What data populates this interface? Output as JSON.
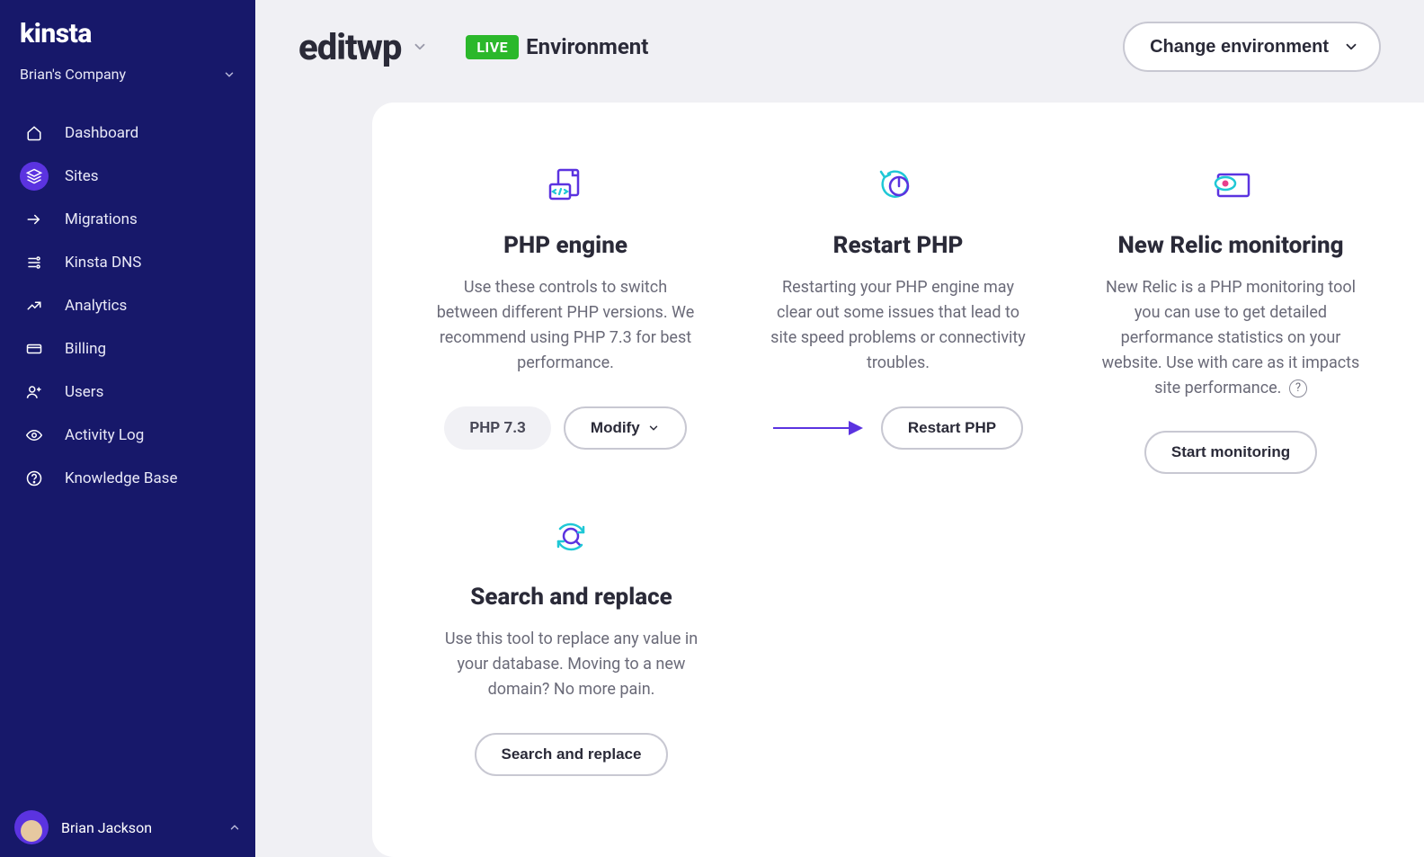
{
  "brand": "KINSTA",
  "company_name": "Brian's Company",
  "nav": [
    {
      "label": "Dashboard",
      "icon": "home-icon"
    },
    {
      "label": "Sites",
      "icon": "layers-icon",
      "active": true
    },
    {
      "label": "Migrations",
      "icon": "migration-icon"
    },
    {
      "label": "Kinsta DNS",
      "icon": "dns-icon"
    },
    {
      "label": "Analytics",
      "icon": "analytics-icon"
    },
    {
      "label": "Billing",
      "icon": "billing-icon"
    },
    {
      "label": "Users",
      "icon": "users-icon"
    },
    {
      "label": "Activity Log",
      "icon": "eye-icon"
    },
    {
      "label": "Knowledge Base",
      "icon": "help-icon"
    }
  ],
  "user_name": "Brian Jackson",
  "header": {
    "site_title": "editwp",
    "live_badge": "LIVE",
    "env_label": "Environment",
    "change_env": "Change environment"
  },
  "cards": {
    "php_engine": {
      "title": "PHP engine",
      "desc": "Use these controls to switch between different PHP versions. We recommend using PHP 7.3 for best performance.",
      "badge": "PHP 7.3",
      "modify": "Modify"
    },
    "restart_php": {
      "title": "Restart PHP",
      "desc": "Restarting your PHP engine may clear out some issues that lead to site speed problems or connectivity troubles.",
      "button": "Restart PHP"
    },
    "new_relic": {
      "title": "New Relic monitoring",
      "desc": "New Relic is a PHP monitoring tool you can use to get detailed performance statistics on your website. Use with care as it impacts site performance.",
      "button": "Start monitoring"
    },
    "search_replace": {
      "title": "Search and replace",
      "desc": "Use this tool to replace any value in your database. Moving to a new domain? No more pain.",
      "button": "Search and replace"
    }
  },
  "colors": {
    "sidebar": "#17186a",
    "accent": "#5b33e0",
    "teal": "#1fc8d6",
    "green": "#2bb82b"
  }
}
